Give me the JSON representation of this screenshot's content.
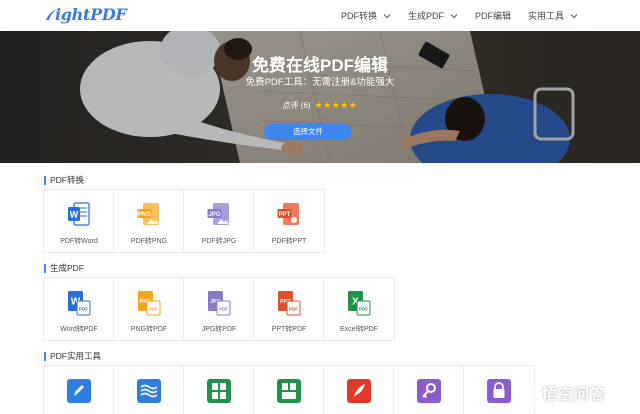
{
  "header": {
    "logo_text": "ightPDF",
    "nav": [
      {
        "label": "PDF转换"
      },
      {
        "label": "生成PDF"
      },
      {
        "label": "PDF编辑"
      },
      {
        "label": "实用工具"
      }
    ]
  },
  "hero": {
    "title": "免费在线PDF编辑",
    "subtitle": "免费PDF工具：无需注册&功能强大",
    "rating_label": "点评 (6)",
    "stars": "★★★★★",
    "button_label": "选择文件"
  },
  "sections": [
    {
      "title": "PDF转换",
      "tools": [
        {
          "label": "PDF转Word",
          "icon": "word-doc-icon",
          "color": "#2b6fd4",
          "tag": "W"
        },
        {
          "label": "PDF转PNG",
          "icon": "png-image-icon",
          "color": "#f4a51c",
          "tag": "PNG"
        },
        {
          "label": "PDF转JPG",
          "icon": "jpg-image-icon",
          "color": "#8a79c9",
          "tag": "JPG"
        },
        {
          "label": "PDF转PPT",
          "icon": "ppt-slide-icon",
          "color": "#e0502c",
          "tag": "PPT"
        }
      ]
    },
    {
      "title": "生成PDF",
      "tools": [
        {
          "label": "Word转PDF",
          "icon": "word-to-pdf-icon",
          "color": "#2b6fd4",
          "tag": "W"
        },
        {
          "label": "PNG转PDF",
          "icon": "png-to-pdf-icon",
          "color": "#f4a51c",
          "tag": "PNG"
        },
        {
          "label": "JPG转PDF",
          "icon": "jpg-to-pdf-icon",
          "color": "#8a79c9",
          "tag": "JPG"
        },
        {
          "label": "PPT转PDF",
          "icon": "ppt-to-pdf-icon",
          "color": "#e0502c",
          "tag": "PPT"
        },
        {
          "label": "Excel转PDF",
          "icon": "excel-to-pdf-icon",
          "color": "#21924a",
          "tag": "X"
        }
      ]
    },
    {
      "title": "PDF实用工具",
      "tools": [
        {
          "label": "",
          "icon": "edit-pen-icon",
          "color": "#2f7de1"
        },
        {
          "label": "",
          "icon": "watermark-waves-icon",
          "color": "#2f7de1"
        },
        {
          "label": "",
          "icon": "split-pages-icon",
          "color": "#21924a"
        },
        {
          "label": "",
          "icon": "merge-pages-icon",
          "color": "#21924a"
        },
        {
          "label": "",
          "icon": "sign-feather-icon",
          "color": "#e0392c"
        },
        {
          "label": "",
          "icon": "unlock-key-icon",
          "color": "#8a5ccf"
        },
        {
          "label": "",
          "icon": "lock-icon",
          "color": "#8a5ccf"
        }
      ]
    }
  ],
  "watermark": {
    "text": "悟空问答"
  },
  "colors": {
    "accent": "#3d86f0",
    "star": "#ffc21a"
  }
}
